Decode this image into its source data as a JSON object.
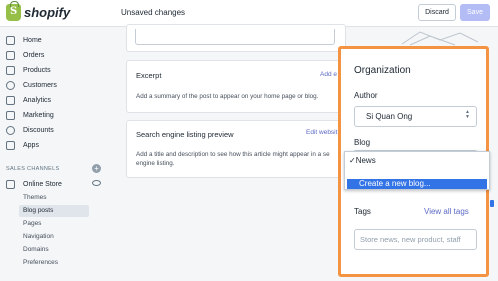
{
  "header": {
    "brand": "shopify",
    "status": "Unsaved changes",
    "discard_label": "Discard",
    "save_label": "Save"
  },
  "sidebar": {
    "items": [
      {
        "label": "Home",
        "icon": "home-icon"
      },
      {
        "label": "Orders",
        "icon": "orders-icon"
      },
      {
        "label": "Products",
        "icon": "products-icon"
      },
      {
        "label": "Customers",
        "icon": "customers-icon"
      },
      {
        "label": "Analytics",
        "icon": "analytics-icon"
      },
      {
        "label": "Marketing",
        "icon": "marketing-icon"
      },
      {
        "label": "Discounts",
        "icon": "discounts-icon"
      },
      {
        "label": "Apps",
        "icon": "apps-icon"
      }
    ],
    "section_label": "SALES CHANNELS",
    "online_store": "Online Store",
    "sub_items": [
      "Themes",
      "Blog posts",
      "Pages",
      "Navigation",
      "Domains",
      "Preferences"
    ]
  },
  "excerpt": {
    "title": "Excerpt",
    "link": "Add e",
    "text": "Add a summary of the post to appear on your home page or blog."
  },
  "seo": {
    "title": "Search engine listing preview",
    "link": "Edit websit",
    "text_line1": "Add a title and description to see how this article might appear in a se",
    "text_line2": "engine listing."
  },
  "organization": {
    "title": "Organization",
    "author_label": "Author",
    "author_value": "Si Quan Ong",
    "blog_label": "Blog",
    "blog_options": [
      "News",
      "Create a new blog..."
    ],
    "tags_label": "Tags",
    "view_all_tags": "View all tags",
    "tags_placeholder": "Store news, new product, staff"
  },
  "colors": {
    "highlight_border": "#f49342",
    "selected_option": "#3273e6",
    "link": "#5c6ac4"
  }
}
